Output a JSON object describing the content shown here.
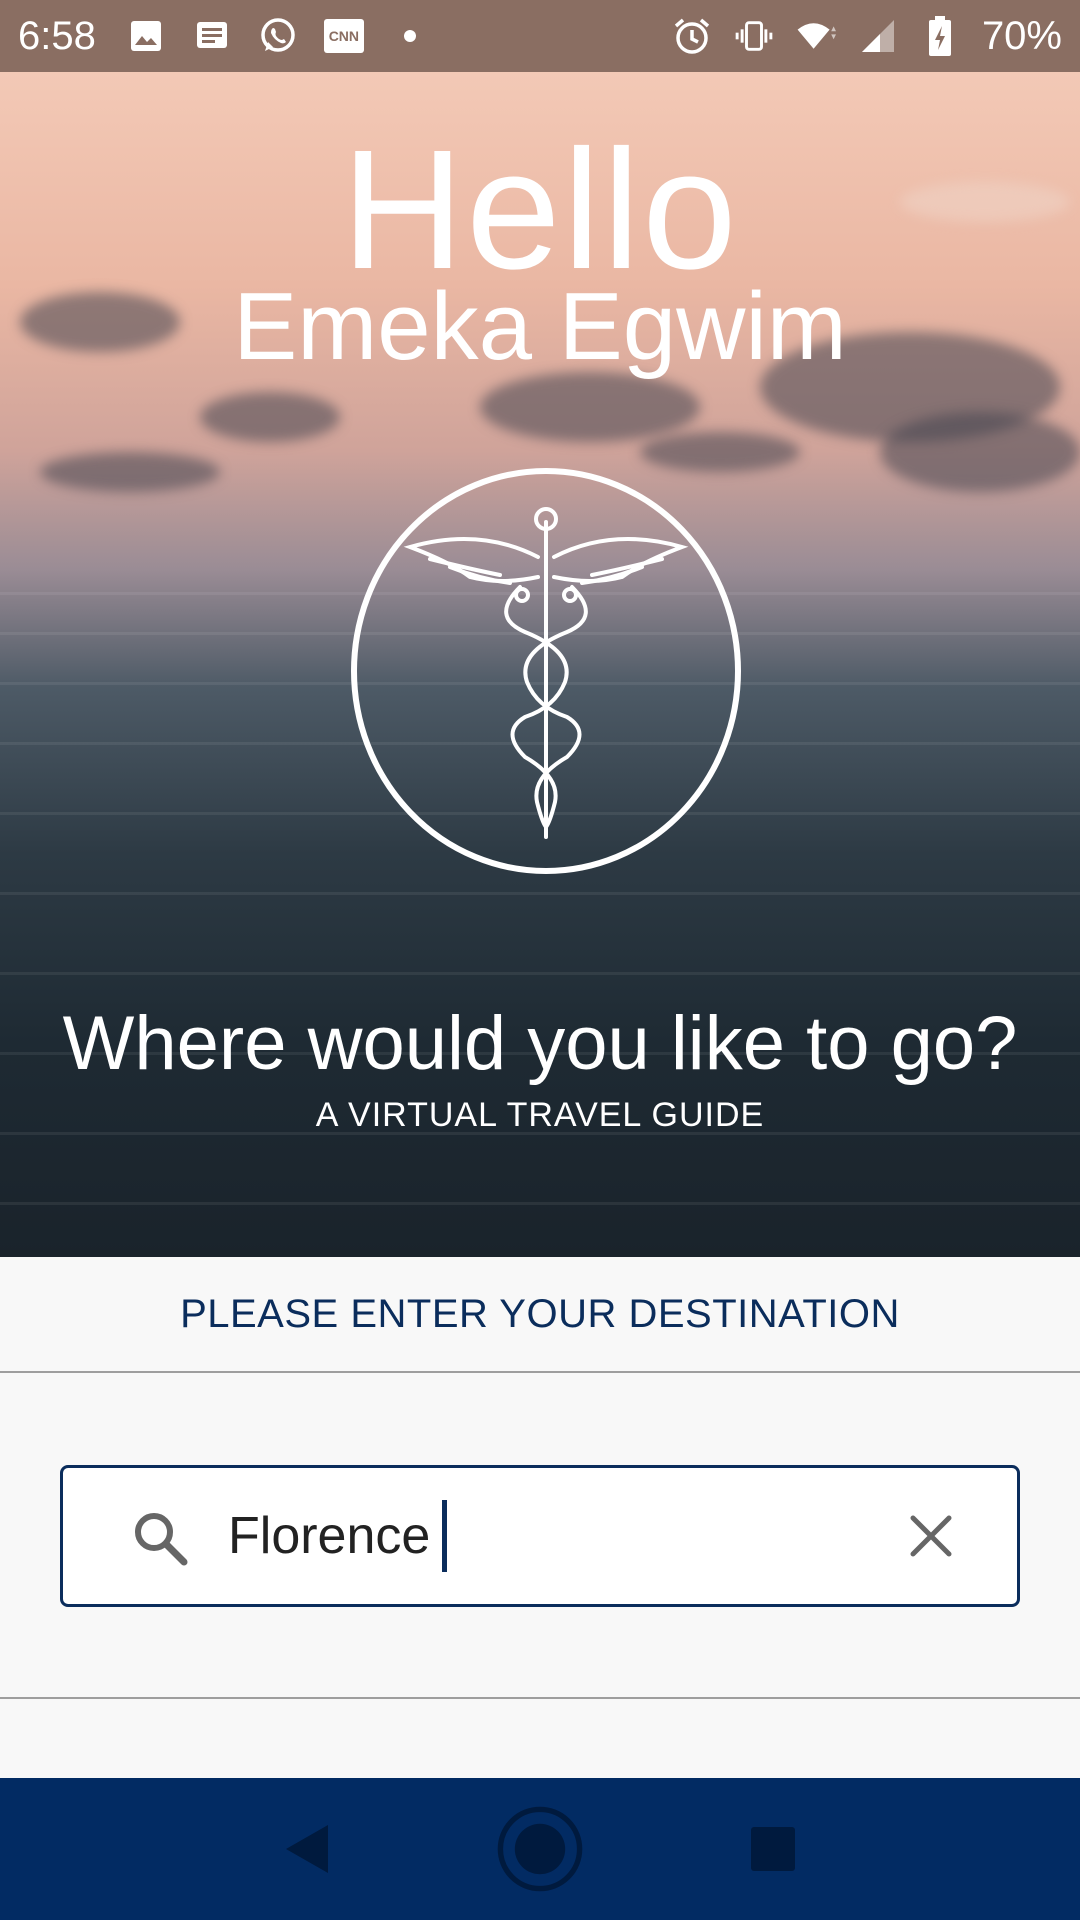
{
  "status_bar": {
    "time": "6:58",
    "battery_percent": "70%",
    "icons_left": [
      "image-icon",
      "message-icon",
      "whatsapp-icon",
      "cnn-icon",
      "dot-icon"
    ],
    "icons_right": [
      "alarm-icon",
      "vibrate-icon",
      "wifi-icon",
      "signal-icon",
      "battery-icon"
    ],
    "cnn_label": "CNN"
  },
  "hero": {
    "greeting": "Hello",
    "user_name": "Emeka Egwim",
    "emblem_icon": "caduceus-icon",
    "question": "Where would you like to go?",
    "subtitle": "A VIRTUAL TRAVEL GUIDE"
  },
  "destination": {
    "label": "PLEASE ENTER YOUR DESTINATION",
    "search_value": "Florence",
    "search_icon": "search-icon",
    "clear_icon": "close-icon"
  },
  "nav_bar": {
    "buttons": [
      "back-icon",
      "home-icon",
      "recents-icon"
    ]
  },
  "colors": {
    "status_bar": "#8a6e62",
    "accent": "#0b2d5c",
    "nav_bar": "#022b63"
  }
}
